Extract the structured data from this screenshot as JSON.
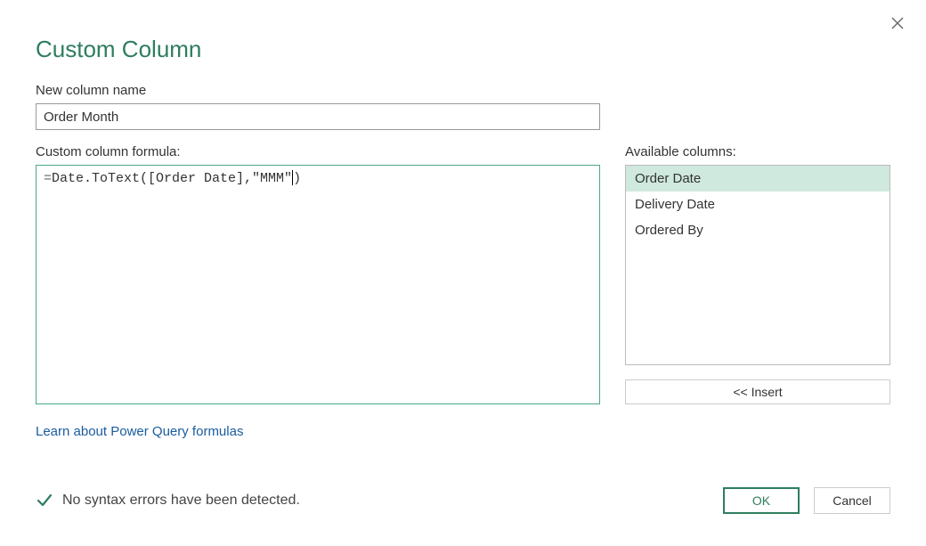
{
  "dialog": {
    "title": "Custom Column"
  },
  "column_name": {
    "label": "New column name",
    "value": "Order Month"
  },
  "formula": {
    "label": "Custom column formula:",
    "prefix": "=",
    "before_cursor": "Date.ToText([Order Date],\"MMM\"",
    "after_cursor": ")"
  },
  "available_columns": {
    "label": "Available columns:",
    "items": [
      "Order Date",
      "Delivery Date",
      "Ordered By"
    ],
    "selected_index": 0
  },
  "insert_button": {
    "label": "<< Insert"
  },
  "learn_link": {
    "text": "Learn about Power Query formulas"
  },
  "status": {
    "text": "No syntax errors have been detected."
  },
  "buttons": {
    "ok": "OK",
    "cancel": "Cancel"
  }
}
